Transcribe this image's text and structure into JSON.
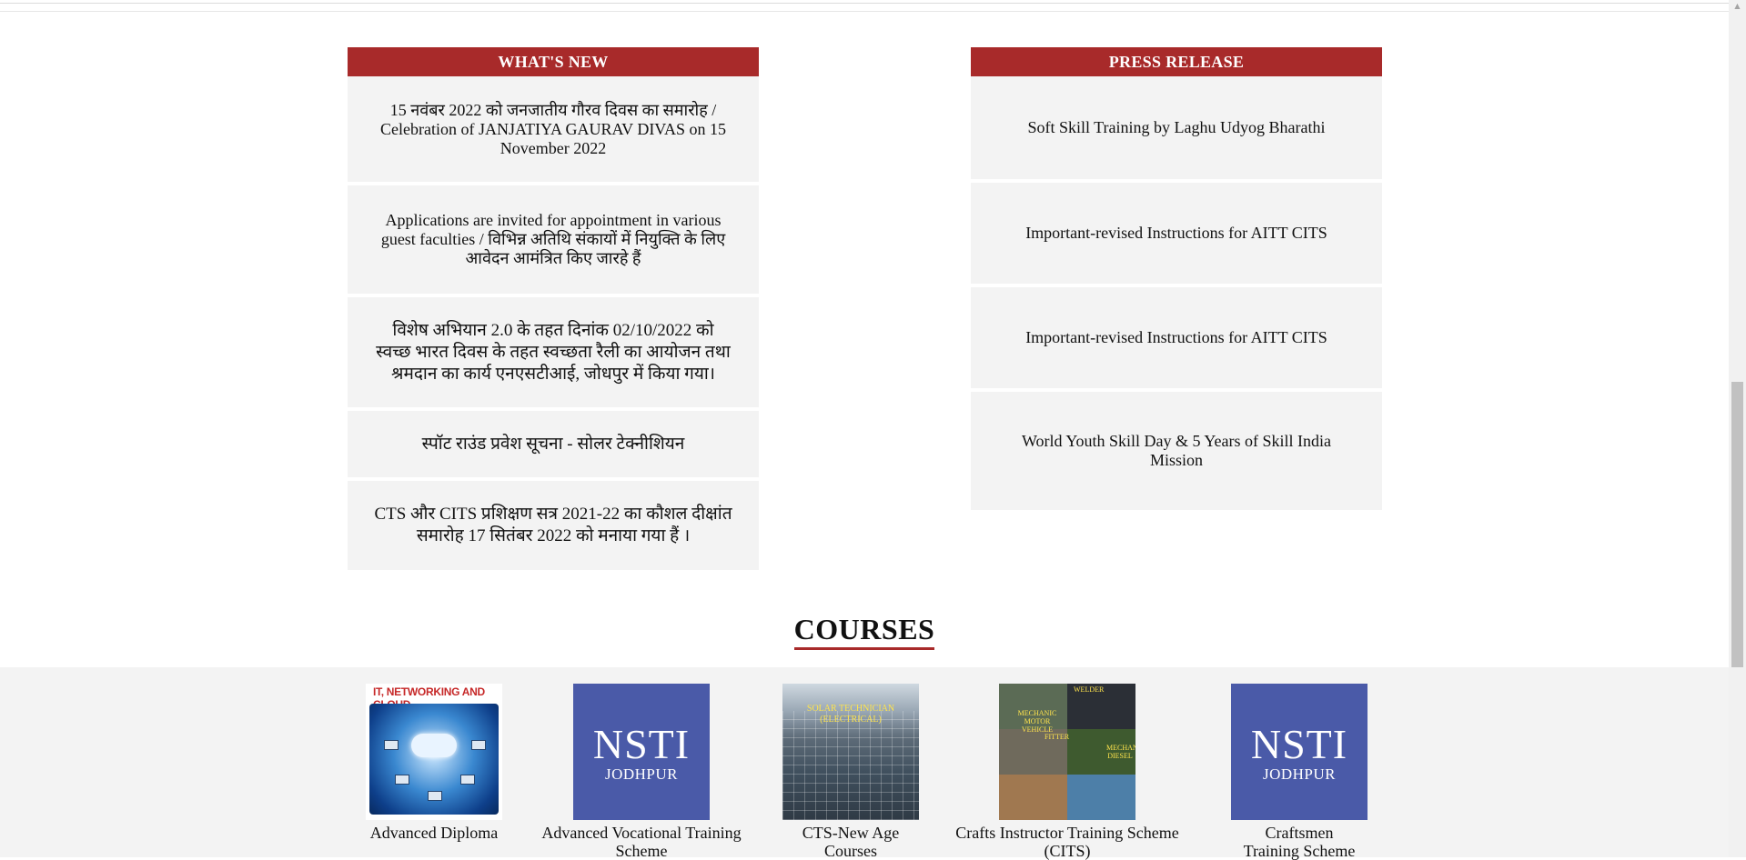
{
  "whats_new": {
    "heading": "WHAT'S NEW",
    "items": [
      "15 नवंबर 2022 को जनजातीय गौरव दिवस का समारोह / Celebration of JANJATIYA GAURAV DIVAS on 15 November 2022",
      "Applications are invited for appointment in various guest faculties / विभिन्न अतिथि संकायों में नियुक्ति के लिए आवेदन आमंत्रित किए जारहे हैं",
      "विशेष अभियान 2.0 के तहत दिनांक 02/10/2022 को स्वच्छ भारत दिवस के तहत स्वच्छता रैली का आयोजन तथा श्रमदान का कार्य एनएसटीआई, जोधपुर में किया गया।",
      "स्पॉट राउंड प्रवेश सूचना - सोलर टेक्नीशियन",
      "CTS और CITS प्रशिक्षण सत्र 2021-22 का कौशल दीक्षांत समारोह 17 सितंबर 2022 को मनाया गया हैं ।"
    ]
  },
  "press_release": {
    "heading": "PRESS RELEASE",
    "items": [
      "Soft Skill Training by Laghu Udyog Bharathi",
      "Important-revised Instructions for AITT CITS",
      "Important-revised Instructions for AITT CITS",
      "World Youth Skill Day & 5 Years of Skill India Mission"
    ]
  },
  "courses": {
    "title": "COURSES",
    "items": [
      {
        "label": "Advanced Diploma",
        "thumb_caption": "IT, NETWORKING AND CLOUD"
      },
      {
        "label": "Advanced Vocational Training Scheme",
        "logo_big": "NSTI",
        "logo_small": "JODHPUR"
      },
      {
        "label": "CTS-New Age Courses",
        "thumb_caption": "SOLAR TECHNICIAN (ELECTRICAL)"
      },
      {
        "label": "Crafts Instructor Training Scheme (CITS)",
        "thumb_labels": [
          "WELDER",
          "FITTER",
          "MECHANIC DIESEL",
          "MECHANIC MOTOR VEHICLE"
        ]
      },
      {
        "label": "Craftsmen Training Scheme",
        "logo_big": "NSTI",
        "logo_small": "JODHPUR"
      }
    ]
  },
  "colors": {
    "accent": "#a82a2a",
    "logo_blue": "#4a5aa8",
    "item_bg": "#f3f3f3"
  }
}
